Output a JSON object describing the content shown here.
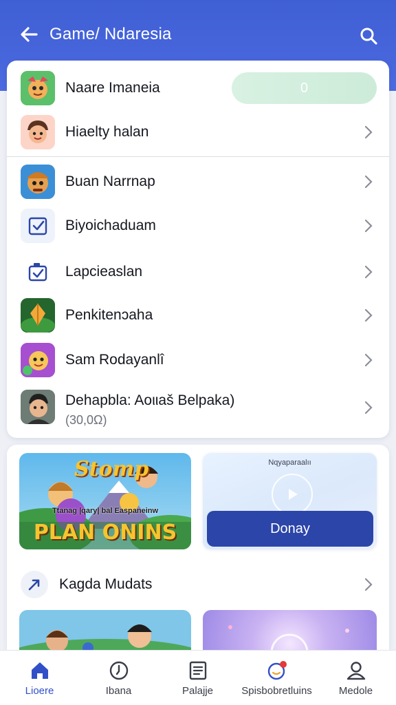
{
  "header": {
    "title": "Game/ Ndaresia",
    "back_icon": "arrow-left-icon",
    "search_icon": "search-icon",
    "background": "#4462d8"
  },
  "list": {
    "toggle_row": {
      "label": "Naare Imaneia",
      "pill_value": "0",
      "pill_color": "#d5efdf"
    },
    "rows": [
      {
        "label": "Hiaelty halan"
      },
      {
        "label": "Buan Narrnap"
      },
      {
        "label": "Biyoichaduam"
      },
      {
        "label": "Lapcieaslan"
      },
      {
        "label": "Penkitenɔaha"
      },
      {
        "label": "Sam Rodayanlî"
      },
      {
        "label": "Dehapbla: Aoιιaš Belpaka)",
        "sub_label": "(30,0Ω)"
      }
    ]
  },
  "content": {
    "game_banner": {
      "title": "Stomp",
      "subtitle": "Ttanag |qary| bal Easpaneinw",
      "headline": "PLAN ONINS"
    },
    "promo_banner": {
      "caption": "Nqyaparaalıı",
      "button_label": "Donay"
    },
    "section": {
      "title": "Kagda Mudats",
      "icon": "trend-arrow-icon"
    }
  },
  "bottom_nav": {
    "items": [
      {
        "label": "Lioere",
        "icon": "home-icon",
        "active": true
      },
      {
        "label": "Ibana",
        "icon": "clock-icon",
        "active": false
      },
      {
        "label": "Palajje",
        "icon": "document-icon",
        "active": false
      },
      {
        "label": "Spisbobretluins",
        "icon": "chat-icon",
        "active": false,
        "badge": true
      },
      {
        "label": "Medole",
        "icon": "user-icon",
        "active": false
      }
    ],
    "accent": "#3150c8"
  }
}
